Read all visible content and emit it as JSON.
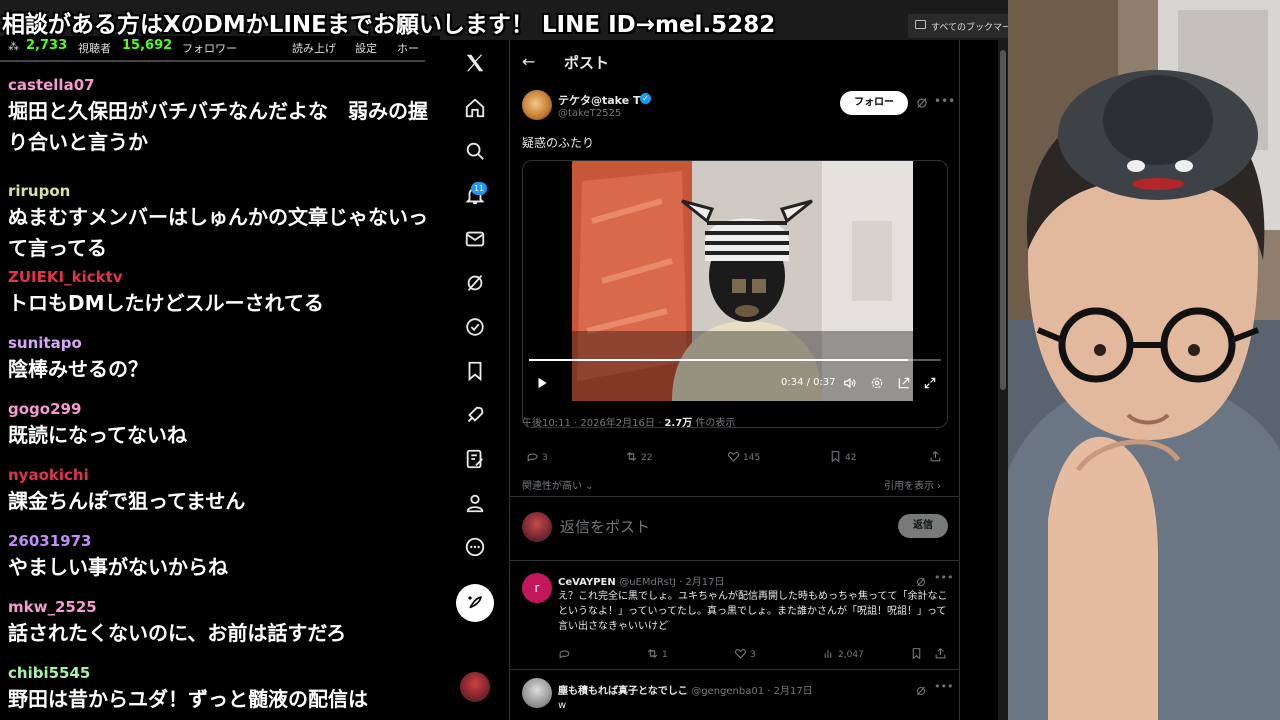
{
  "banner": {
    "text": "相談がある方はXのDMかLINEまでお願いします！ LINE ID→mel.5282"
  },
  "browser": {
    "bookmarks_label": "すべてのブックマーク"
  },
  "chat": {
    "viewers_count": "2,733",
    "viewers_label": "視聴者",
    "followers_count": "15,692",
    "followers_label": "フォロワー",
    "read_aloud": "読み上げ",
    "settings": "設定",
    "home": "ホー",
    "messages": [
      {
        "user": "castella07",
        "color": "#f59bd0",
        "text": "堀田と久保田がバチバチなんだよな　弱みの握り合いと言うか"
      },
      {
        "user": "rirupon",
        "color": "#d7e3a0",
        "text": "ぬまむすメンバーはしゅんかの文章じゃないって言ってる"
      },
      {
        "user": "ZUIEKI_kicktv",
        "color": "#e0344a",
        "text": "トロもDMしたけどスルーされてる"
      },
      {
        "user": "sunitapo",
        "color": "#d7a6f5",
        "text": "陰棒みせるの？"
      },
      {
        "user": "gogo299",
        "color": "#f59bd0",
        "text": "既読になってないね"
      },
      {
        "user": "nyaokichi",
        "color": "#e0344a",
        "text": "課金ちんぽで狙ってません"
      },
      {
        "user": "26031973",
        "color": "#c08cf5",
        "text": "やましい事がないからね"
      },
      {
        "user": "mkw_2525",
        "color": "#f59bd0",
        "text": "話されたくないのに、お前は話すだろ"
      },
      {
        "user": "chibi5545",
        "color": "#a8f0a8",
        "text": "野田は昔からユダ！ずっと髄液の配信は"
      }
    ]
  },
  "x_nav": {
    "items": [
      "x-logo",
      "home-icon",
      "search-icon",
      "notifications-icon",
      "messages-icon",
      "grok-icon",
      "verified-icon",
      "bookmarks-icon",
      "rocket-icon",
      "edit-list-icon",
      "profile-icon",
      "more-icon"
    ],
    "notification_count": "11"
  },
  "post": {
    "back": "←",
    "header": "ポスト",
    "author_name": "テケタ@take T",
    "author_handle": "@takeT2525",
    "follow_label": "フォロー",
    "text": "疑惑のふたり",
    "video": {
      "time": "0:34 / 0:37",
      "progress": 0.92
    },
    "meta_time": "午後10:11 · 2026年2月16日 · ",
    "meta_views": "2.7万",
    "meta_views_suffix": " 件の表示",
    "replies": "3",
    "reposts": "22",
    "likes": "145",
    "bookmarks": "42",
    "relevance": "関連性が高い ⌄",
    "quotes_link": "引用を表示 ›",
    "reply_placeholder": "返信をポスト",
    "reply_button": "返信"
  },
  "replies": [
    {
      "avatar_letter": "r",
      "avatar_color": "#c2185b",
      "name": "CeVAYPEN",
      "handle": "@uEMdRstJ · 2月17日",
      "text": "え？これ完全に黒でしょ。ユキちゃんが配信再開した時もめっちゃ焦ってて「余計なこというなよ！」っていってたし。真っ黒でしょ。また誰かさんが「呪詛！呪詛！」って言い出さなきゃいいけど",
      "replies": "",
      "reposts": "1",
      "likes": "3",
      "views": "2,047"
    },
    {
      "avatar_letter": "",
      "avatar_color": "#888888",
      "name": "塵も積もれば真子となでしこ",
      "handle": "@gengenba01 · 2月17日",
      "text": "w"
    }
  ]
}
